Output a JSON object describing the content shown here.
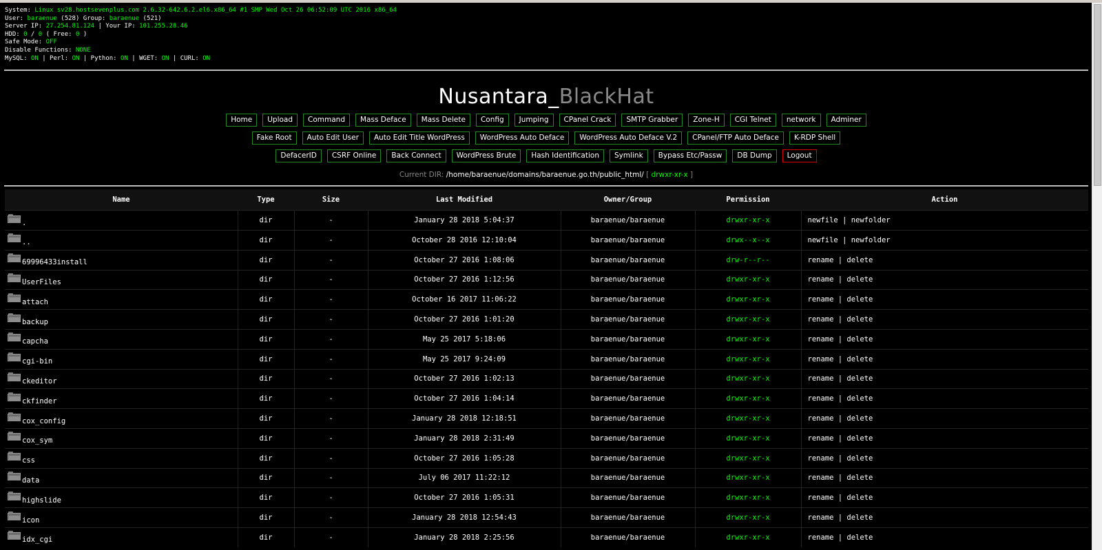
{
  "sysinfo": {
    "system_label": "System: ",
    "system_value": "Linux sv28.hostsevenplus.com 2.6.32-642.6.2.el6.x86_64 #1 SMP Wed Oct 26 06:52:09 UTC 2016 x86_64",
    "user_label": "User: ",
    "user_value": "baraenue",
    "user_id": " (528) Group: ",
    "group_value": "baraenue",
    "group_id": " (521)",
    "server_ip_label": "Server IP: ",
    "server_ip": "27.254.81.124",
    "your_ip_label": " | Your IP: ",
    "your_ip": "101.255.28.46",
    "hdd_label": "HDD: ",
    "hdd_used": "0",
    "hdd_sep": " / ",
    "hdd_total": "0",
    "hdd_free_label": " ( Free: ",
    "hdd_free": "0",
    "hdd_end": " )",
    "safe_mode_label": "Safe Mode: ",
    "safe_mode": "OFF",
    "disable_label": "Disable Functions: ",
    "disable_value": "NONE",
    "mysql_label": "MySQL: ",
    "mysql": "ON",
    "perl_label": " | Perl: ",
    "perl": "ON",
    "python_label": " | Python: ",
    "python": "ON",
    "wget_label": " | WGET: ",
    "wget": "ON",
    "curl_label": " | CURL: ",
    "curl": "ON"
  },
  "title": {
    "part1": "Nusantara_",
    "part2": "BlackHat"
  },
  "menu_row1": [
    "Home",
    "Upload",
    "Command",
    "Mass Deface",
    "Mass Delete",
    "Config",
    "Jumping",
    "CPanel Crack",
    "SMTP Grabber",
    "Zone-H",
    "CGI Telnet",
    "network",
    "Adminer"
  ],
  "menu_row2": [
    "Fake Root",
    "Auto Edit User",
    "Auto Edit Title WordPress",
    "WordPress Auto Deface",
    "WordPress Auto Deface V.2",
    "CPanel/FTP Auto Deface",
    "K-RDP Shell"
  ],
  "menu_row3": [
    "DefacerID",
    "CSRF Online",
    "Back Connect",
    "WordPress Brute",
    "Hash Identification",
    "Symlink",
    "Bypass Etc/Passw",
    "DB Dump"
  ],
  "logout_label": "Logout",
  "current_dir": {
    "label": "Current DIR: ",
    "path": "/home/baraenue/domains/baraenue.go.th/public_html/",
    "open": " [ ",
    "perm": "drwxr-xr-x",
    "close": " ]"
  },
  "table": {
    "headers": {
      "name": "Name",
      "type": "Type",
      "size": "Size",
      "modified": "Last Modified",
      "owner": "Owner/Group",
      "perm": "Permission",
      "action": "Action"
    },
    "rows": [
      {
        "name": ".",
        "type": "dir",
        "size": "-",
        "modified": "January 28 2018 5:04:37",
        "owner": "baraenue/baraenue",
        "perm": "drwxr-xr-x",
        "action": "newfile | newfolder"
      },
      {
        "name": "..",
        "type": "dir",
        "size": "-",
        "modified": "October 28 2016 12:10:04",
        "owner": "baraenue/baraenue",
        "perm": "drwx--x--x",
        "action": "newfile | newfolder"
      },
      {
        "name": "69996433install",
        "type": "dir",
        "size": "-",
        "modified": "October 27 2016 1:08:06",
        "owner": "baraenue/baraenue",
        "perm": "drw-r--r--",
        "action": "rename | delete"
      },
      {
        "name": "UserFiles",
        "type": "dir",
        "size": "-",
        "modified": "October 27 2016 1:12:56",
        "owner": "baraenue/baraenue",
        "perm": "drwxr-xr-x",
        "action": "rename | delete"
      },
      {
        "name": "attach",
        "type": "dir",
        "size": "-",
        "modified": "October 16 2017 11:06:22",
        "owner": "baraenue/baraenue",
        "perm": "drwxr-xr-x",
        "action": "rename | delete"
      },
      {
        "name": "backup",
        "type": "dir",
        "size": "-",
        "modified": "October 27 2016 1:01:20",
        "owner": "baraenue/baraenue",
        "perm": "drwxr-xr-x",
        "action": "rename | delete"
      },
      {
        "name": "capcha",
        "type": "dir",
        "size": "-",
        "modified": "May 25 2017 5:18:06",
        "owner": "baraenue/baraenue",
        "perm": "drwxr-xr-x",
        "action": "rename | delete"
      },
      {
        "name": "cgi-bin",
        "type": "dir",
        "size": "-",
        "modified": "May 25 2017 9:24:09",
        "owner": "baraenue/baraenue",
        "perm": "drwxr-xr-x",
        "action": "rename | delete"
      },
      {
        "name": "ckeditor",
        "type": "dir",
        "size": "-",
        "modified": "October 27 2016 1:02:13",
        "owner": "baraenue/baraenue",
        "perm": "drwxr-xr-x",
        "action": "rename | delete"
      },
      {
        "name": "ckfinder",
        "type": "dir",
        "size": "-",
        "modified": "October 27 2016 1:04:14",
        "owner": "baraenue/baraenue",
        "perm": "drwxr-xr-x",
        "action": "rename | delete"
      },
      {
        "name": "cox_config",
        "type": "dir",
        "size": "-",
        "modified": "January 28 2018 12:18:51",
        "owner": "baraenue/baraenue",
        "perm": "drwxr-xr-x",
        "action": "rename | delete"
      },
      {
        "name": "cox_sym",
        "type": "dir",
        "size": "-",
        "modified": "January 28 2018 2:31:49",
        "owner": "baraenue/baraenue",
        "perm": "drwxr-xr-x",
        "action": "rename | delete"
      },
      {
        "name": "css",
        "type": "dir",
        "size": "-",
        "modified": "October 27 2016 1:05:28",
        "owner": "baraenue/baraenue",
        "perm": "drwxr-xr-x",
        "action": "rename | delete"
      },
      {
        "name": "data",
        "type": "dir",
        "size": "-",
        "modified": "July 06 2017 11:22:12",
        "owner": "baraenue/baraenue",
        "perm": "drwxr-xr-x",
        "action": "rename | delete"
      },
      {
        "name": "highslide",
        "type": "dir",
        "size": "-",
        "modified": "October 27 2016 1:05:31",
        "owner": "baraenue/baraenue",
        "perm": "drwxr-xr-x",
        "action": "rename | delete"
      },
      {
        "name": "icon",
        "type": "dir",
        "size": "-",
        "modified": "January 28 2018 12:54:43",
        "owner": "baraenue/baraenue",
        "perm": "drwxr-xr-x",
        "action": "rename | delete"
      },
      {
        "name": "idx_cgi",
        "type": "dir",
        "size": "-",
        "modified": "January 28 2018 2:25:56",
        "owner": "baraenue/baraenue",
        "perm": "drwxr-xr-x",
        "action": "rename | delete"
      }
    ]
  },
  "colors": {
    "accent_green": "#00ff00",
    "button_border": "#228b22",
    "logout_border": "#dd0000",
    "background": "#000000"
  },
  "icons": {
    "folder": "folder-icon"
  }
}
